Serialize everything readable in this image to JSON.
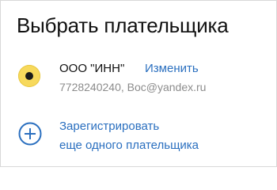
{
  "dialog": {
    "title": "Выбрать плательщика"
  },
  "payer": {
    "name": "ООО \"ИНН\"",
    "edit_label": "Изменить",
    "details": "7728240240, Вос@yandex.ru",
    "selected": true
  },
  "register": {
    "line1": "Зарегистрировать",
    "line2": "еще одного плательщика",
    "icon": "plus-circle-icon"
  },
  "colors": {
    "accent": "#2a6fbf",
    "radio_fill": "#f7d95c",
    "muted_text": "#8c8c8c"
  }
}
